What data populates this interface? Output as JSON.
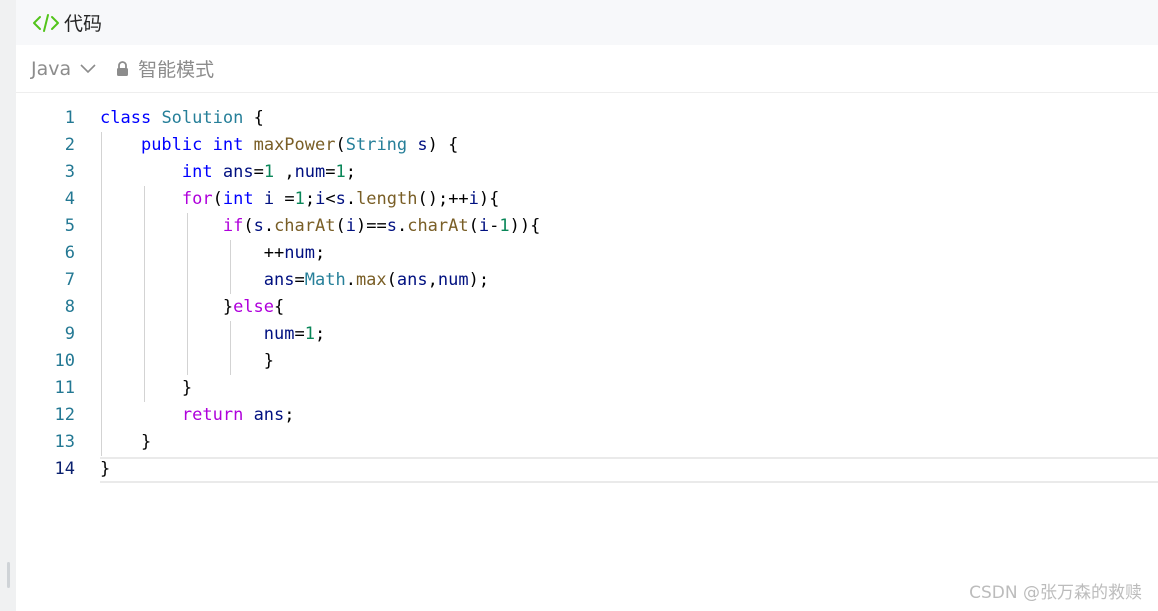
{
  "header": {
    "title": "代码",
    "icon": "code-icon",
    "icon_color": "#52c41a"
  },
  "toolbar": {
    "language": "Java",
    "mode_label": "智能模式",
    "lock_icon": "lock-icon"
  },
  "editor": {
    "active_line": 14,
    "lines": [
      {
        "n": "1",
        "tokens": [
          {
            "t": "class",
            "c": "kw"
          },
          {
            "t": " "
          },
          {
            "t": "Solution",
            "c": "ty"
          },
          {
            "t": " {"
          }
        ]
      },
      {
        "n": "2",
        "tokens": [
          {
            "t": "    "
          },
          {
            "t": "public",
            "c": "kw"
          },
          {
            "t": " "
          },
          {
            "t": "int",
            "c": "kw"
          },
          {
            "t": " "
          },
          {
            "t": "maxPower",
            "c": "fn"
          },
          {
            "t": "("
          },
          {
            "t": "String",
            "c": "ty"
          },
          {
            "t": " "
          },
          {
            "t": "s",
            "c": "va"
          },
          {
            "t": ") {"
          }
        ]
      },
      {
        "n": "3",
        "tokens": [
          {
            "t": "        "
          },
          {
            "t": "int",
            "c": "kw"
          },
          {
            "t": " "
          },
          {
            "t": "ans",
            "c": "va"
          },
          {
            "t": "="
          },
          {
            "t": "1",
            "c": "nm"
          },
          {
            "t": " ,"
          },
          {
            "t": "num",
            "c": "va"
          },
          {
            "t": "="
          },
          {
            "t": "1",
            "c": "nm"
          },
          {
            "t": ";"
          }
        ]
      },
      {
        "n": "4",
        "tokens": [
          {
            "t": "        "
          },
          {
            "t": "for",
            "c": "ctl"
          },
          {
            "t": "("
          },
          {
            "t": "int",
            "c": "kw"
          },
          {
            "t": " "
          },
          {
            "t": "i",
            "c": "va"
          },
          {
            "t": " ="
          },
          {
            "t": "1",
            "c": "nm"
          },
          {
            "t": ";"
          },
          {
            "t": "i",
            "c": "va"
          },
          {
            "t": "<"
          },
          {
            "t": "s",
            "c": "va"
          },
          {
            "t": "."
          },
          {
            "t": "length",
            "c": "fn"
          },
          {
            "t": "();++"
          },
          {
            "t": "i",
            "c": "va"
          },
          {
            "t": "){"
          }
        ]
      },
      {
        "n": "5",
        "tokens": [
          {
            "t": "            "
          },
          {
            "t": "if",
            "c": "ctl"
          },
          {
            "t": "("
          },
          {
            "t": "s",
            "c": "va"
          },
          {
            "t": "."
          },
          {
            "t": "charAt",
            "c": "fn"
          },
          {
            "t": "("
          },
          {
            "t": "i",
            "c": "va"
          },
          {
            "t": ")=="
          },
          {
            "t": "s",
            "c": "va"
          },
          {
            "t": "."
          },
          {
            "t": "charAt",
            "c": "fn"
          },
          {
            "t": "("
          },
          {
            "t": "i",
            "c": "va"
          },
          {
            "t": "-"
          },
          {
            "t": "1",
            "c": "nm"
          },
          {
            "t": ")){"
          }
        ]
      },
      {
        "n": "6",
        "tokens": [
          {
            "t": "                "
          },
          {
            "t": "++"
          },
          {
            "t": "num",
            "c": "va"
          },
          {
            "t": ";"
          }
        ]
      },
      {
        "n": "7",
        "tokens": [
          {
            "t": "                "
          },
          {
            "t": "ans",
            "c": "va"
          },
          {
            "t": "="
          },
          {
            "t": "Math",
            "c": "ty"
          },
          {
            "t": "."
          },
          {
            "t": "max",
            "c": "fn"
          },
          {
            "t": "("
          },
          {
            "t": "ans",
            "c": "va"
          },
          {
            "t": ","
          },
          {
            "t": "num",
            "c": "va"
          },
          {
            "t": ");"
          }
        ]
      },
      {
        "n": "8",
        "tokens": [
          {
            "t": "            }"
          },
          {
            "t": "else",
            "c": "ctl"
          },
          {
            "t": "{"
          }
        ]
      },
      {
        "n": "9",
        "tokens": [
          {
            "t": "                "
          },
          {
            "t": "num",
            "c": "va"
          },
          {
            "t": "="
          },
          {
            "t": "1",
            "c": "nm"
          },
          {
            "t": ";"
          }
        ]
      },
      {
        "n": "10",
        "tokens": [
          {
            "t": "                }"
          }
        ]
      },
      {
        "n": "11",
        "tokens": [
          {
            "t": "        }"
          }
        ]
      },
      {
        "n": "12",
        "tokens": [
          {
            "t": "        "
          },
          {
            "t": "return",
            "c": "ctl"
          },
          {
            "t": " "
          },
          {
            "t": "ans",
            "c": "va"
          },
          {
            "t": ";"
          }
        ]
      },
      {
        "n": "13",
        "tokens": [
          {
            "t": "    }"
          }
        ]
      },
      {
        "n": "14",
        "tokens": [
          {
            "t": "}"
          }
        ]
      }
    ]
  },
  "watermark": "CSDN @张万森的救赎"
}
